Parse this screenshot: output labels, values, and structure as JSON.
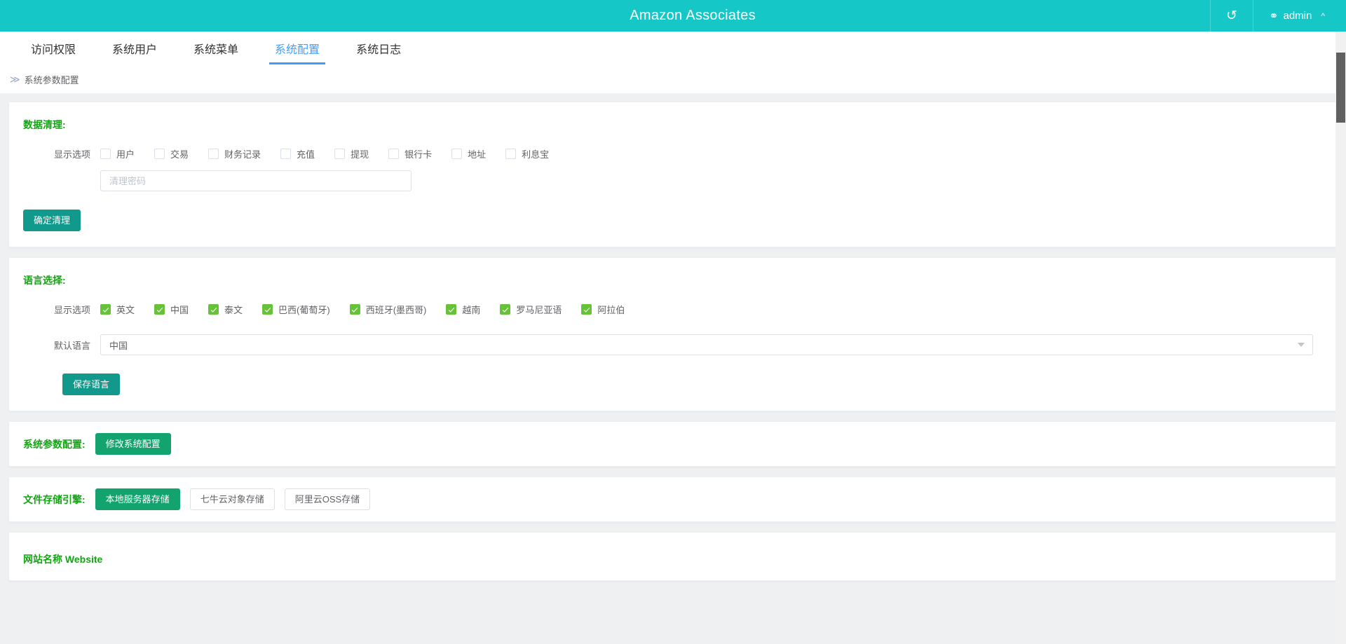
{
  "topbar": {
    "title": "Amazon Associates",
    "refresh_icon": "refresh-icon",
    "user_icon": "user-icon",
    "user_name": "admin",
    "caret_icon": "chevron-up-icon",
    "bg_color": "#16c7c7"
  },
  "tabs": [
    {
      "label": "访问权限",
      "active": false
    },
    {
      "label": "系统用户",
      "active": false
    },
    {
      "label": "系统菜单",
      "active": false
    },
    {
      "label": "系统配置",
      "active": true
    },
    {
      "label": "系统日志",
      "active": false
    }
  ],
  "breadcrumb": {
    "separator": "≫",
    "current": "系统参数配置"
  },
  "data_clean": {
    "title": "数据清理:",
    "options_label": "显示选项",
    "options": [
      {
        "label": "用户",
        "checked": false
      },
      {
        "label": "交易",
        "checked": false
      },
      {
        "label": "财务记录",
        "checked": false
      },
      {
        "label": "充值",
        "checked": false
      },
      {
        "label": "提现",
        "checked": false
      },
      {
        "label": "银行卡",
        "checked": false
      },
      {
        "label": "地址",
        "checked": false
      },
      {
        "label": "利息宝",
        "checked": false
      }
    ],
    "password_value": "",
    "password_placeholder": "清理密码",
    "submit_label": "确定清理"
  },
  "language": {
    "title": "语言选择:",
    "options_label": "显示选项",
    "options": [
      {
        "label": "英文",
        "checked": true
      },
      {
        "label": "中国",
        "checked": true
      },
      {
        "label": "泰文",
        "checked": true
      },
      {
        "label": "巴西(葡萄牙)",
        "checked": true
      },
      {
        "label": "西班牙(墨西哥)",
        "checked": true
      },
      {
        "label": "越南",
        "checked": true
      },
      {
        "label": "罗马尼亚语",
        "checked": true
      },
      {
        "label": "阿拉伯",
        "checked": true
      }
    ],
    "default_label": "默认语言",
    "default_value": "中国",
    "save_label": "保存语言"
  },
  "sys_params": {
    "label": "系统参数配置:",
    "button_label": "修改系统配置"
  },
  "storage": {
    "label": "文件存储引擎:",
    "engines": [
      {
        "label": "本地服务器存储",
        "active": true
      },
      {
        "label": "七牛云对象存储",
        "active": false
      },
      {
        "label": "阿里云OSS存储",
        "active": false
      }
    ]
  },
  "bottom": {
    "website_label": "网站名称 Website"
  },
  "colors": {
    "teal": "#16c7c7",
    "accent_blue": "#409EFF",
    "green_label": "#13a413",
    "button_teal": "#119a8c",
    "checkbox_green": "#67c23a"
  }
}
